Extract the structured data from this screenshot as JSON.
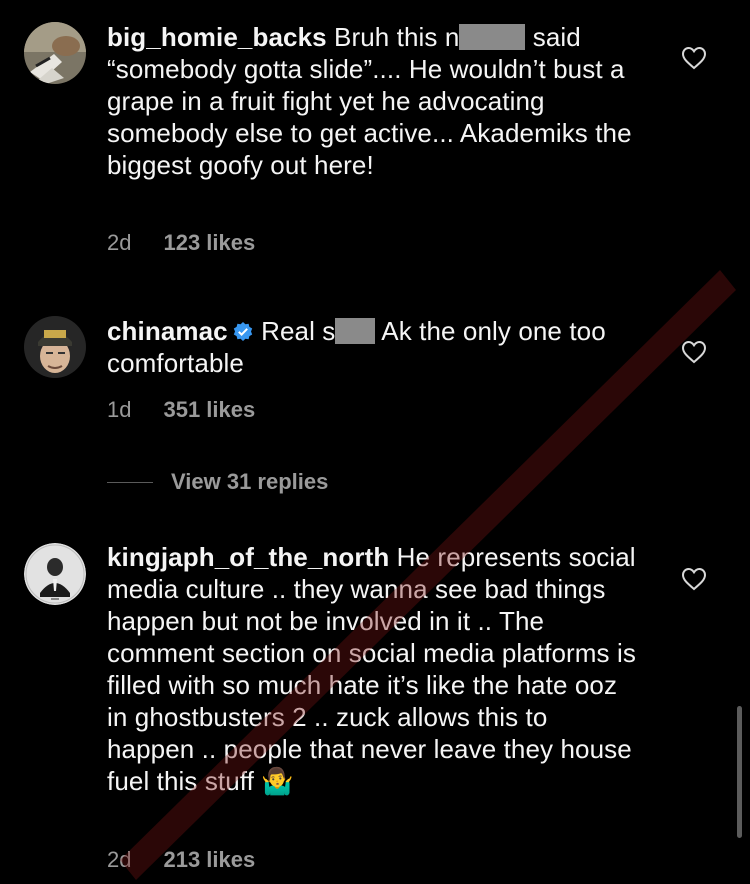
{
  "comments": [
    {
      "username": "big_homie_backs",
      "text_before_censor": "Bruh this n",
      "text_after_censor": " said",
      "text_rest": "“somebody gotta slide”.... He wouldn’t bust a grape in a fruit fight yet he advocating somebody else to get active... Akademiks the biggest goofy out here!",
      "time": "2d",
      "likes": "123 likes",
      "verified": false
    },
    {
      "username": "chinamac",
      "text_before_censor": "Real s",
      "text_after_censor": " Ak the only one",
      "text_rest": "too comfortable",
      "time": "1d",
      "likes": "351 likes",
      "verified": true,
      "view_replies": "View 31 replies"
    },
    {
      "username": "kingjaph_of_the_north",
      "text": "He represents social media culture .. they wanna see bad things happen but not be involved in it .. The comment section on social media platforms is filled with so much hate it’s like the hate ooz in ghostbusters 2 .. zuck allows this to happen .. people that never leave they house fuel this stuff",
      "emoji": "🤷‍♂️",
      "time": "2d",
      "likes": "213 likes",
      "verified": false
    }
  ],
  "icons": {
    "like": "heart-outline-icon",
    "verified": "verified-badge-icon"
  },
  "colors": {
    "background": "#000000",
    "text": "#f5f5f5",
    "meta": "#9a9a9a",
    "verified": "#3897f0",
    "censor": "#8a8a8a"
  }
}
